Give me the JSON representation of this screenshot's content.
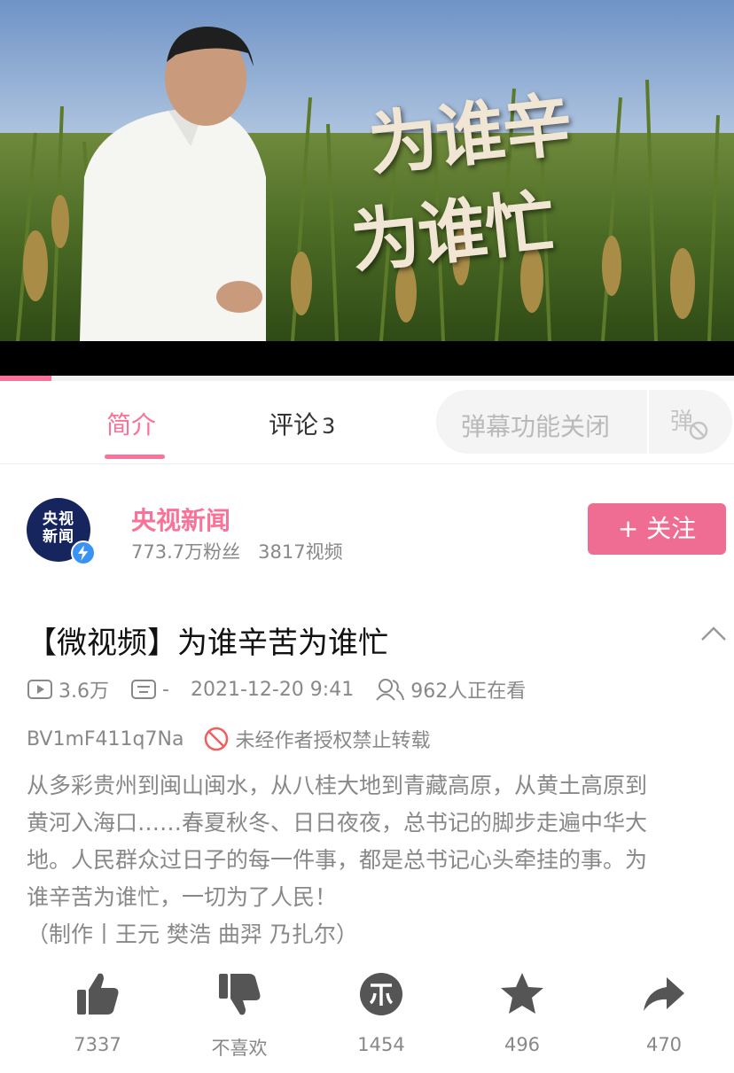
{
  "video": {
    "overlay_title_line1": "为谁辛",
    "overlay_title_line2": "为谁忙",
    "progress": 0.07,
    "accent_color": "#fb7299"
  },
  "tabs": {
    "intro_label": "简介",
    "comments_label": "评论",
    "comments_count": "3"
  },
  "danmaku": {
    "placeholder": "弹幕功能关闭",
    "toggle_icon": "danmaku-off-icon"
  },
  "uploader": {
    "avatar_text": "央视\n新闻",
    "name": "央视新闻",
    "followers": "773.7万粉丝",
    "videos": "3817视频",
    "follow_label": "+ 关注",
    "verified_icon": "lightning-verified-icon"
  },
  "info": {
    "title": "【微视频】为谁辛苦为谁忙",
    "plays": "3.6万",
    "danmaku_count": "-",
    "datetime": "2021-12-20 9:41",
    "watching": "962人正在看",
    "bv_id": "BV1mF411q7Na",
    "no_repost": "未经作者授权禁止转载",
    "description": "从多彩贵州到闽山闽水，从八桂大地到青藏高原，从黄土高原到\n黄河入海口……春夏秋冬、日日夜夜，总书记的脚步走遍中华大\n地。人民群众过日子的每一件事，都是总书记心头牵挂的事。为\n谁辛苦为谁忙，一切为了人民！\n（制作丨王元 樊浩 曲羿 乃扎尔）"
  },
  "actions": [
    {
      "icon": "thumbs-up-icon",
      "label": "7337"
    },
    {
      "icon": "thumbs-down-icon",
      "label": "不喜欢"
    },
    {
      "icon": "coin-icon",
      "label": "1454"
    },
    {
      "icon": "star-icon",
      "label": "496"
    },
    {
      "icon": "share-icon",
      "label": "470"
    }
  ]
}
